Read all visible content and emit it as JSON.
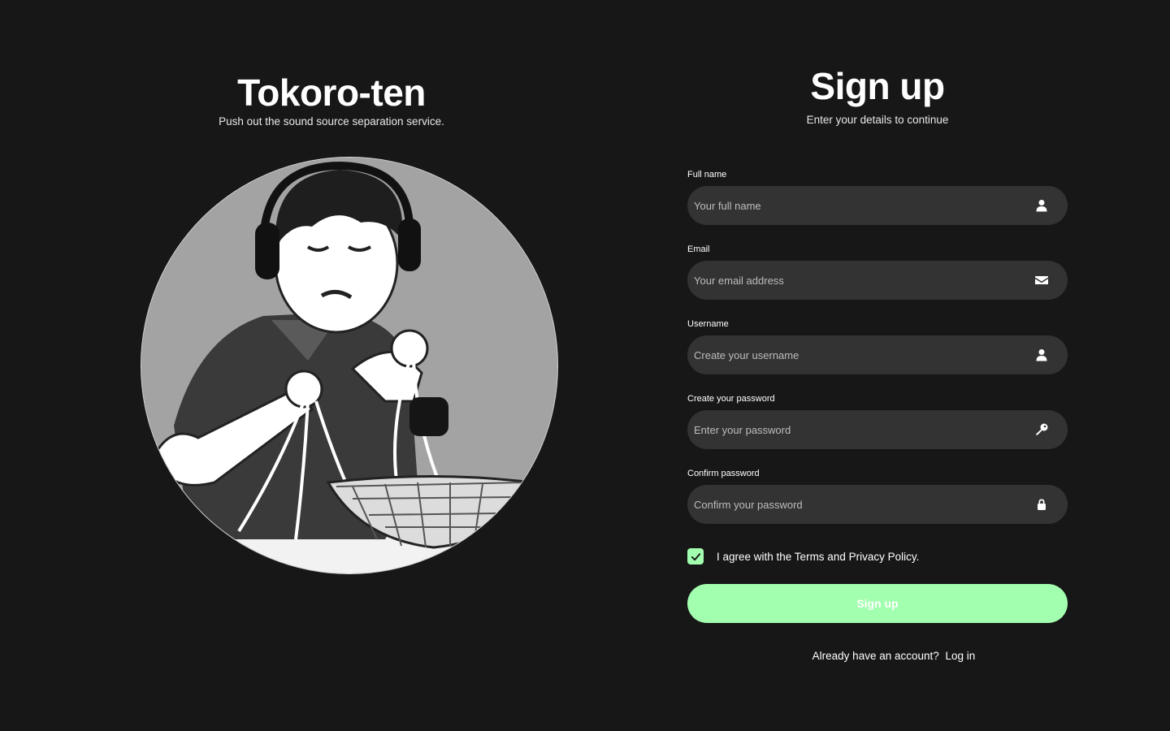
{
  "brand": {
    "title": "Tokoro-ten",
    "tagline": "Push out the sound source separation service.",
    "illustration": "monochrome illustration of a boy wearing headphones pulling noodles"
  },
  "form": {
    "title": "Sign up",
    "subtitle": "Enter your details to continue",
    "fields": [
      {
        "label": "Full name",
        "placeholder": "Your full name",
        "value": "",
        "icon": "user-icon"
      },
      {
        "label": "Email",
        "placeholder": "Your email address",
        "value": "",
        "icon": "envelope-icon"
      },
      {
        "label": "Username",
        "placeholder": "Create your username",
        "value": "",
        "icon": "user-icon"
      },
      {
        "label": "Create your password",
        "placeholder": "Enter your password",
        "value": "",
        "icon": "key-icon"
      },
      {
        "label": "Confirm password",
        "placeholder": "Confirm your password",
        "value": "",
        "icon": "lock-icon"
      }
    ],
    "agree": {
      "checked": true,
      "text": "I agree with the Terms and Privacy Policy."
    },
    "submit_label": "Sign up",
    "login_prompt": "Already have an account?",
    "login_link": "Log in"
  },
  "colors": {
    "background": "#171717",
    "input_background": "#333333",
    "accent": "#a3ffb0",
    "text": "#ffffff"
  }
}
